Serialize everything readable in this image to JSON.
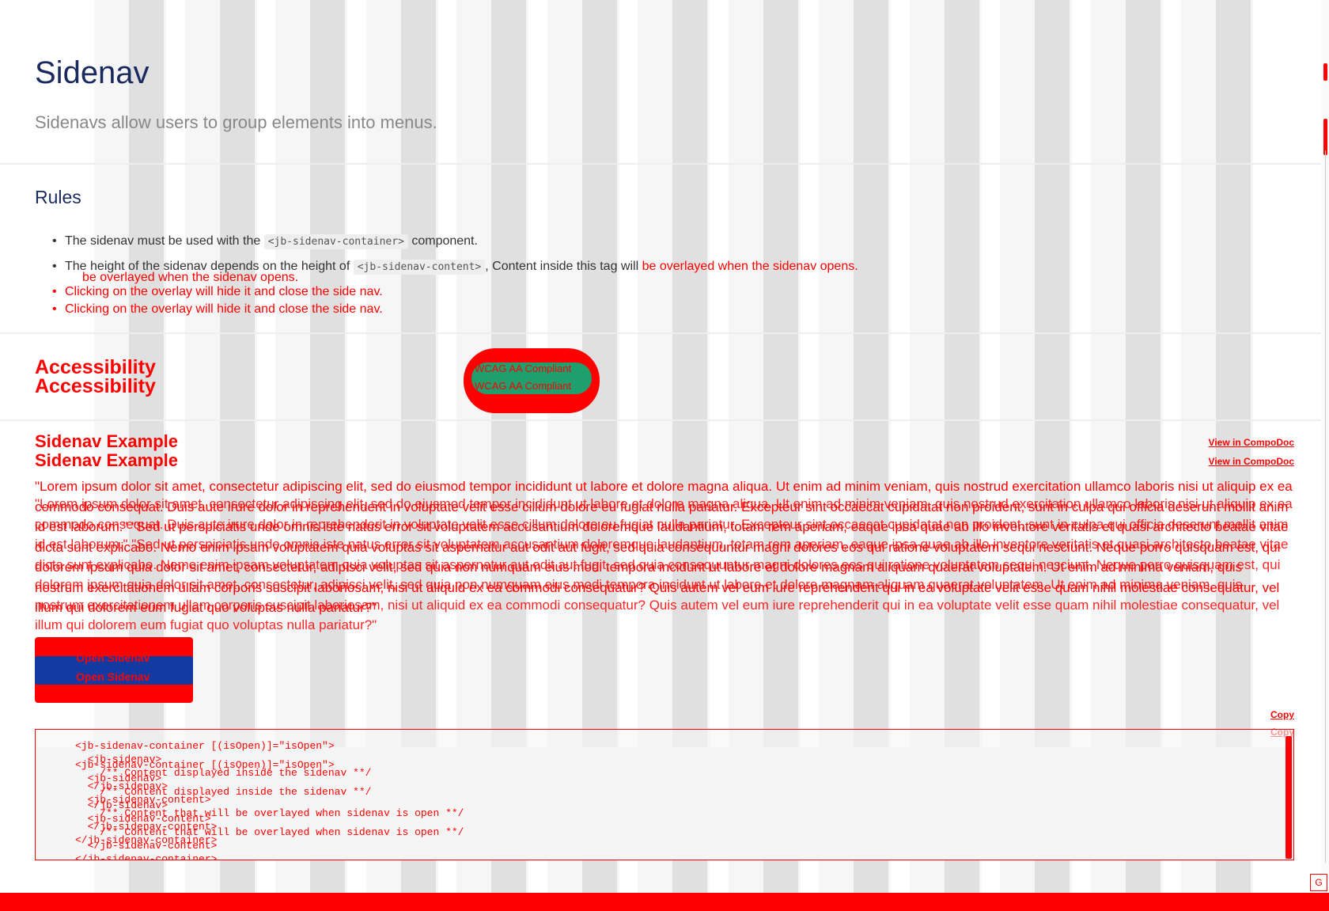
{
  "page": {
    "title": "Sidenav",
    "subtitle": "Sidenavs allow users to group elements into menus."
  },
  "rules": {
    "title": "Rules",
    "items": [
      {
        "before": "The sidenav must be used with the ",
        "code": "<jb-sidenav-container>",
        "after": " component."
      },
      {
        "before": "The height of the sidenav depends on the height of ",
        "code": "<jb-sidenav-content>",
        "after": ", Content inside this tag will ",
        "highlight": "be overlayed when the sidenav opens."
      },
      {
        "text": "Clicking on the overlay will hide it and close the side nav."
      },
      {
        "text": "Clicking on the overlay will hide it and close the side nav."
      }
    ],
    "ghost_text": "be overlayed when the sidenav opens."
  },
  "accessibility": {
    "title": "Accessibility",
    "badge": "WCAG AA Compliant"
  },
  "example": {
    "title": "Sidenav Example",
    "compodoc_link": "View in CompoDoc",
    "lorem": "\"Lorem ipsum dolor sit amet, consectetur adipiscing elit, sed do eiusmod tempor incididunt ut labore et dolore magna aliqua. Ut enim ad minim veniam, quis nostrud exercitation ullamco laboris nisi ut aliquip ex ea commodo consequat. Duis aute irure dolor in reprehenderit in voluptate velit esse cillum dolore eu fugiat nulla pariatur. Excepteur sint occaecat cupidatat non proident, sunt in culpa qui officia deserunt mollit anim id est laborum.\" \"Sed ut perspiciatis unde omnis iste natus error sit voluptatem accusantium doloremque laudantium, totam rem aperiam, eaque ipsa quae ab illo inventore veritatis et quasi architecto beatae vitae dicta sunt explicabo. Nemo enim ipsam voluptatem quia voluptas sit aspernatur aut odit aut fugit, sed quia consequuntur magni dolores eos qui ratione voluptatem sequi nesciunt. Neque porro quisquam est, qui dolorem ipsum quia dolor sit amet, consectetur, adipisci velit, sed quia non numquam eius modi tempora incidunt ut labore et dolore magnam aliquam quaerat voluptatem. Ut enim ad minima veniam, quis nostrum exercitationem ullam corporis suscipit laboriosam, nisi ut aliquid ex ea commodi consequatur? Quis autem vel eum iure reprehenderit qui in ea voluptate velit esse quam nihil molestiae consequatur, vel illum qui dolorem eum fugiat quo voluptas nulla pariatur?\"",
    "open_button": "Open Sidenav",
    "copy_link": "Copy",
    "code": "<jb-sidenav-container [(isOpen)]=\"isOpen\">\n  <jb-sidenav>\n    /** Content displayed inside the sidenav **/\n  </jb-sidenav>\n  <jb-sidenav-content>\n    /** Content that will be overlayed when sidenav is open **/\n  </jb-sidenav-content>\n</jb-sidenav-container>"
  },
  "corner_button": "G",
  "colors": {
    "heading": "#1a2a5e",
    "accent_red": "#ff0000",
    "badge_green": "#1f9e6e",
    "button_blue": "#123aa0"
  }
}
